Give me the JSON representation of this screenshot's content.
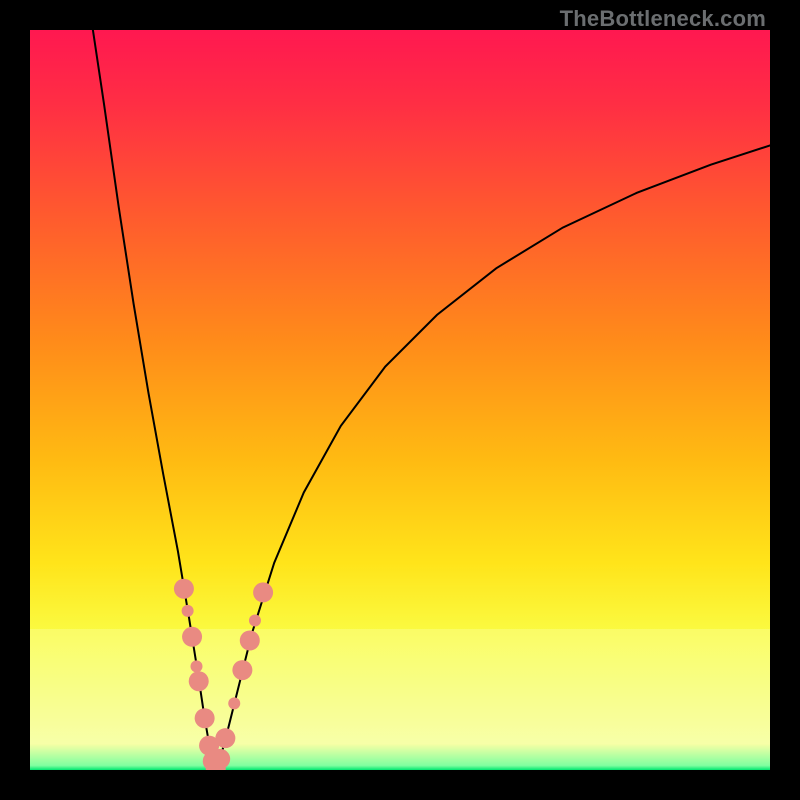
{
  "watermark": {
    "text": "TheBottleneck.com"
  },
  "chart_data": {
    "type": "line",
    "title": "",
    "xlabel": "",
    "ylabel": "",
    "xlim": [
      0,
      100
    ],
    "ylim": [
      0,
      100
    ],
    "grid": false,
    "legend": false,
    "background_gradient": {
      "orientation": "vertical",
      "stops": [
        {
          "pos": 0.0,
          "color": "#ff1850"
        },
        {
          "pos": 0.1,
          "color": "#ff2e44"
        },
        {
          "pos": 0.25,
          "color": "#ff5a2e"
        },
        {
          "pos": 0.42,
          "color": "#ff8b1a"
        },
        {
          "pos": 0.58,
          "color": "#ffba12"
        },
        {
          "pos": 0.72,
          "color": "#ffe41a"
        },
        {
          "pos": 0.82,
          "color": "#fafc44"
        },
        {
          "pos": 0.965,
          "color": "#f6ffa5"
        },
        {
          "pos": 0.994,
          "color": "#7fffa0"
        },
        {
          "pos": 1.0,
          "color": "#00e66f"
        }
      ],
      "pale_band": {
        "y_start": 81,
        "y_end": 96.5,
        "color": "#faffb0",
        "opacity": 0.35
      }
    },
    "series": [
      {
        "name": "bottleneck-curve-left",
        "color": "#000000",
        "stroke_width": 2,
        "x": [
          8.5,
          10.0,
          12.0,
          14.0,
          16.0,
          18.0,
          20.0,
          21.5,
          22.7,
          23.6,
          24.3,
          24.8,
          25.1
        ],
        "y": [
          100.0,
          90.0,
          76.0,
          63.0,
          51.0,
          40.0,
          29.5,
          20.5,
          13.0,
          7.0,
          3.0,
          0.8,
          0.0
        ]
      },
      {
        "name": "bottleneck-curve-right",
        "color": "#000000",
        "stroke_width": 2,
        "x": [
          25.1,
          25.6,
          26.5,
          28.0,
          30.0,
          33.0,
          37.0,
          42.0,
          48.0,
          55.0,
          63.0,
          72.0,
          82.0,
          92.0,
          100.0
        ],
        "y": [
          0.0,
          1.2,
          4.5,
          10.5,
          18.5,
          28.0,
          37.5,
          46.5,
          54.5,
          61.5,
          67.8,
          73.3,
          78.0,
          81.8,
          84.4
        ]
      }
    ],
    "scatter": {
      "name": "highlighted-points",
      "color": "#e98a82",
      "radius_major": 10,
      "radius_minor": 6,
      "points": [
        {
          "x": 20.8,
          "y": 24.5,
          "r": 10
        },
        {
          "x": 21.3,
          "y": 21.5,
          "r": 6
        },
        {
          "x": 21.9,
          "y": 18.0,
          "r": 10
        },
        {
          "x": 22.5,
          "y": 14.0,
          "r": 6
        },
        {
          "x": 22.8,
          "y": 12.0,
          "r": 10
        },
        {
          "x": 23.6,
          "y": 7.0,
          "r": 10
        },
        {
          "x": 24.2,
          "y": 3.3,
          "r": 10
        },
        {
          "x": 24.7,
          "y": 1.2,
          "r": 10
        },
        {
          "x": 25.1,
          "y": 0.2,
          "r": 10
        },
        {
          "x": 25.7,
          "y": 1.5,
          "r": 10
        },
        {
          "x": 26.4,
          "y": 4.3,
          "r": 10
        },
        {
          "x": 27.6,
          "y": 9.0,
          "r": 6
        },
        {
          "x": 28.7,
          "y": 13.5,
          "r": 10
        },
        {
          "x": 29.7,
          "y": 17.5,
          "r": 10
        },
        {
          "x": 30.4,
          "y": 20.2,
          "r": 6
        },
        {
          "x": 31.5,
          "y": 24.0,
          "r": 10
        }
      ]
    }
  }
}
